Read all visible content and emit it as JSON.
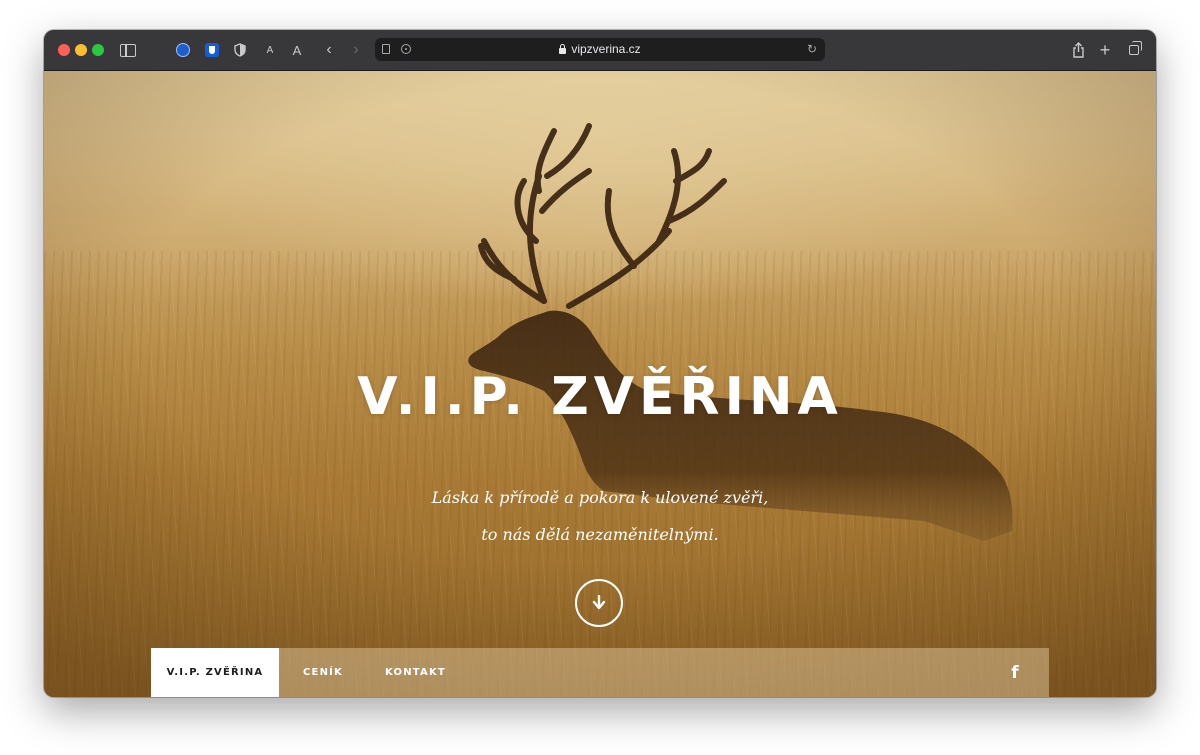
{
  "browser": {
    "url": "vipzverina.cz",
    "font_small_label": "A",
    "font_large_label": "A",
    "back_glyph": "‹",
    "forward_glyph": "›",
    "new_tab_glyph": "+",
    "reload_glyph": "↻",
    "icons": [
      "sidebar-icon",
      "extension-icon",
      "bitwarden-icon",
      "shield-icon",
      "reader-icon",
      "privacy-icon",
      "lock-icon",
      "reload-icon",
      "share-icon",
      "plus-icon",
      "tabs-icon"
    ]
  },
  "hero": {
    "title": "V.I.P. ZVĚŘINA",
    "tagline_line1": "Láska k přírodě a pokora k ulovené zvěři,",
    "tagline_line2": "to nás dělá nezaměnitelnými.",
    "scroll_icon": "arrow-down-icon"
  },
  "nav": {
    "items": [
      {
        "label": "V.I.P. ZVĚŘINA",
        "active": true
      },
      {
        "label": "CENÍK",
        "active": false
      },
      {
        "label": "KONTAKT",
        "active": false
      }
    ],
    "social_glyph": "f"
  },
  "colors": {
    "nav_active_bg": "#ffffff",
    "hero_tone": "#b88d48",
    "url_bar": "#1e1e1f"
  }
}
